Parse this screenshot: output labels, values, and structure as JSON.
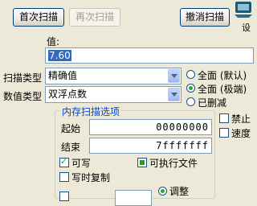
{
  "toolbar": {
    "first_scan_label": "首次扫描",
    "next_scan_label": "再次扫描",
    "undo_scan_label": "撤消扫描",
    "settings_partial_label": "设"
  },
  "value": {
    "label": "值:",
    "current": "7.60"
  },
  "scan_type": {
    "label": "扫描类型",
    "selected": "精确值"
  },
  "value_type": {
    "label": "数值类型",
    "selected": "双浮点数"
  },
  "memory_options": {
    "radios": [
      {
        "label": "全面 (默认)",
        "checked": false
      },
      {
        "label": "全面 (极端)",
        "checked": true
      },
      {
        "label": "已删减",
        "checked": false
      }
    ]
  },
  "memory_scan": {
    "title": "内存扫描选项",
    "start_label": "起始",
    "start_value": "00000000",
    "end_label": "结束",
    "end_value": "7fffffff",
    "writable_label": "可写",
    "writable_checked": true,
    "executable_label": "可执行文件",
    "executable_checked": true,
    "copy_on_write_label": "写时复制",
    "copy_on_write_checked": false,
    "adjust_label": "调整"
  },
  "right_options": {
    "disable_label": "禁止",
    "speed_label": "速度"
  },
  "colors": {
    "window_bg": "#ece9d8",
    "group_title": "#0046d5",
    "selection": "#316ac5"
  }
}
